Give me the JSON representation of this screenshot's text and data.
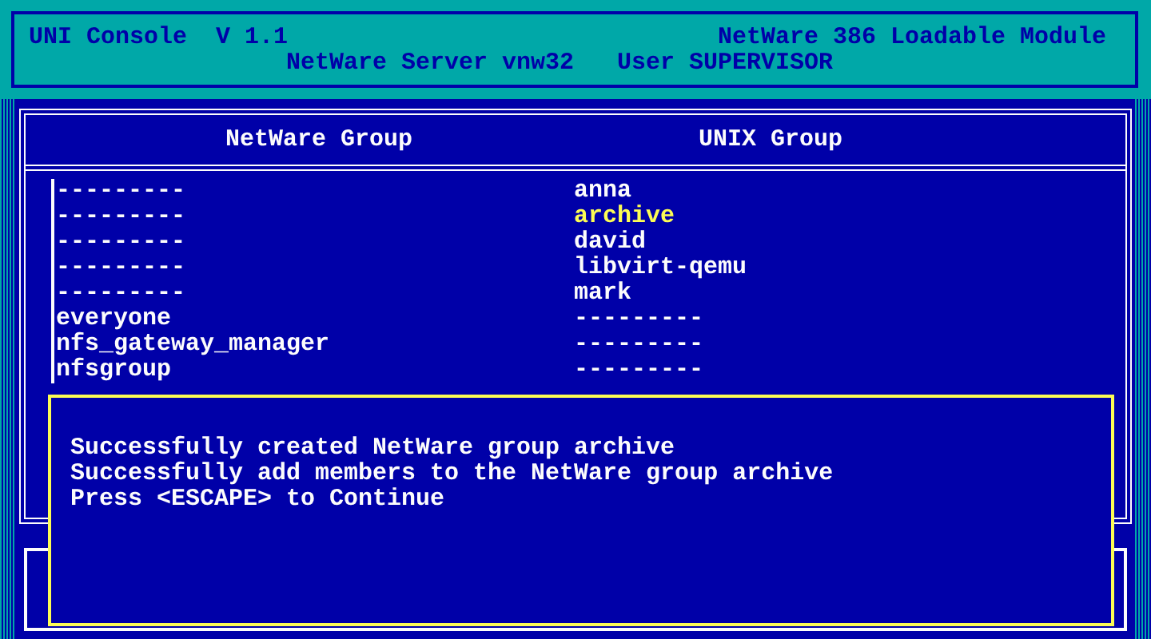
{
  "header": {
    "title": "UNI Console  V 1.1",
    "module": "NetWare 386 Loadable Module",
    "server": "NetWare Server vnw32",
    "user": "User SUPERVISOR"
  },
  "table": {
    "columns": [
      "NetWare Group",
      "UNIX Group"
    ],
    "rows": [
      {
        "netware": "---------",
        "unix": "anna",
        "selected": false
      },
      {
        "netware": "---------",
        "unix": "archive",
        "selected": true
      },
      {
        "netware": "---------",
        "unix": "david",
        "selected": false
      },
      {
        "netware": "---------",
        "unix": "libvirt-qemu",
        "selected": false
      },
      {
        "netware": "---------",
        "unix": "mark",
        "selected": false
      },
      {
        "netware": "everyone",
        "unix": "---------",
        "selected": false
      },
      {
        "netware": "nfs_gateway_manager",
        "unix": "---------",
        "selected": false
      },
      {
        "netware": "nfsgroup",
        "unix": "---------",
        "selected": false
      }
    ]
  },
  "message": {
    "lines": [
      "Successfully created NetWare group archive",
      "Successfully add members to the NetWare group archive",
      "Press <ESCAPE> to Continue"
    ]
  }
}
